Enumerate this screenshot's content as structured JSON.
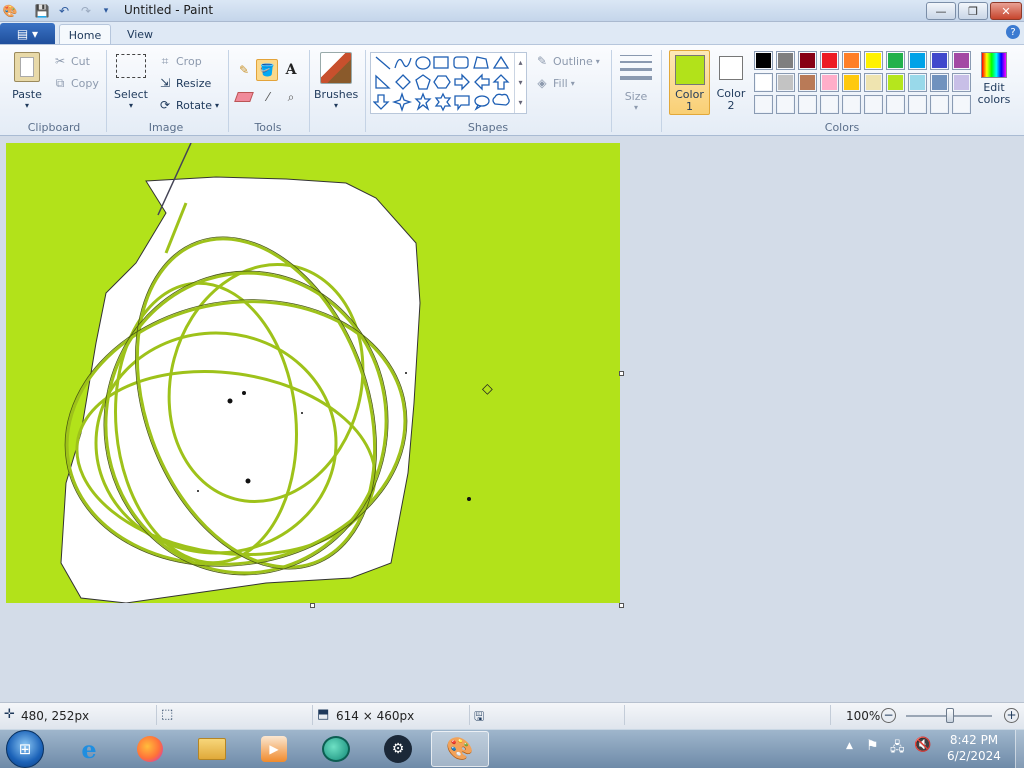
{
  "window": {
    "title": "Untitled - Paint"
  },
  "tabs": {
    "app_menu_icon": "app-menu-icon",
    "home": "Home",
    "view": "View",
    "help": "?"
  },
  "clipboard": {
    "paste": "Paste",
    "cut": "Cut",
    "copy": "Copy",
    "group": "Clipboard"
  },
  "image": {
    "select": "Select",
    "crop": "Crop",
    "resize": "Resize",
    "rotate": "Rotate",
    "group": "Image"
  },
  "tools": {
    "text_tool": "A",
    "group": "Tools"
  },
  "brushes": {
    "label": "Brushes"
  },
  "shapes": {
    "outline": "Outline",
    "fill": "Fill",
    "group": "Shapes"
  },
  "size": {
    "label": "Size"
  },
  "colors": {
    "color1_l1": "Color",
    "color1_l2": "1",
    "color1_value": "#b2e21a",
    "color2_l1": "Color",
    "color2_l2": "2",
    "color2_value": "#ffffff",
    "edit_l1": "Edit",
    "edit_l2": "colors",
    "group": "Colors",
    "palette_row1": [
      "#000000",
      "#7f7f7f",
      "#880015",
      "#ed1c24",
      "#ff7f27",
      "#fff200",
      "#22b14c",
      "#00a2e8",
      "#3f48cc",
      "#a349a4"
    ],
    "palette_row2": [
      "#ffffff",
      "#c3c3c3",
      "#b97a57",
      "#ffaec9",
      "#ffc90e",
      "#efe4b0",
      "#b5e61d",
      "#99d9ea",
      "#7092be",
      "#c8bfe7"
    ]
  },
  "status": {
    "cursor_pos": "480, 252px",
    "canvas_size": "614 × 460px",
    "zoom": "100%"
  },
  "clock": {
    "time": "8:42 PM",
    "date": "6/2/2024"
  },
  "canvas": {
    "background": "#b2e21a"
  }
}
